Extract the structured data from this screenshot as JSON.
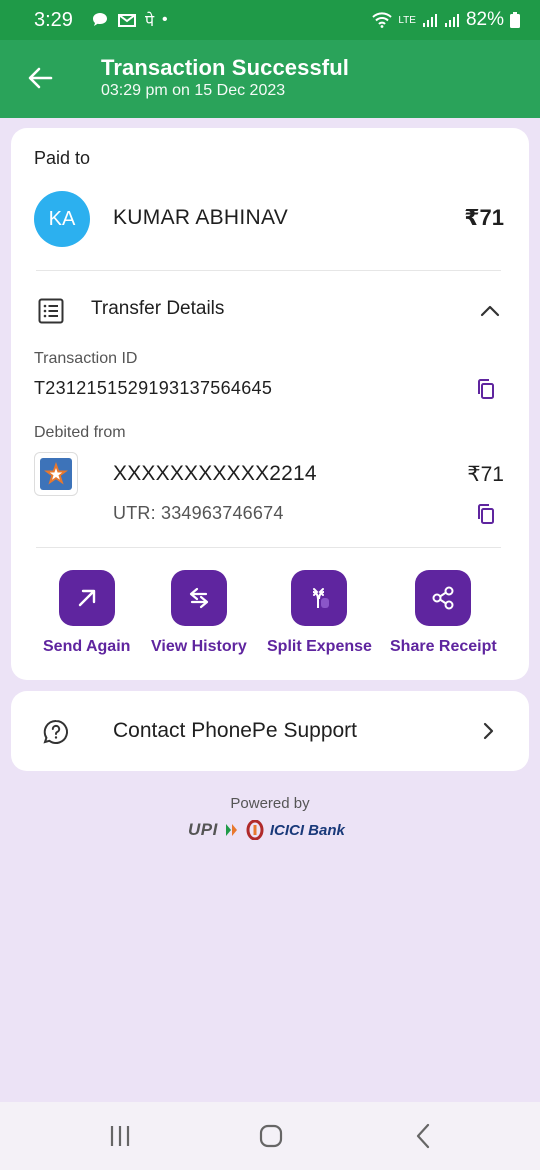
{
  "status_bar": {
    "time": "3:29",
    "net_label": "LTE",
    "battery": "82%"
  },
  "header": {
    "title": "Transaction Successful",
    "subtitle": "03:29 pm on 15 Dec 2023"
  },
  "payee": {
    "section_label": "Paid to",
    "initials": "KA",
    "name": "KUMAR ABHINAV",
    "amount": "₹71"
  },
  "transfer_details": {
    "title": "Transfer Details",
    "transaction_id_label": "Transaction ID",
    "transaction_id": "T2312151529193137564645",
    "debited_from_label": "Debited from",
    "account_number": "XXXXXXXXXXX2214",
    "amount": "₹71",
    "utr": "UTR: 334963746674"
  },
  "actions": [
    {
      "label": "Send Again",
      "icon": "arrow-up-right-icon"
    },
    {
      "label": "View History",
      "icon": "swap-arrows-icon"
    },
    {
      "label": "Split Expense",
      "icon": "split-icon"
    },
    {
      "label": "Share Receipt",
      "icon": "share-icon"
    }
  ],
  "support": {
    "label": "Contact PhonePe Support"
  },
  "footer": {
    "powered_by": "Powered by",
    "upi": "UPI",
    "bank": "ICICI Bank"
  },
  "colors": {
    "status_green": "#1f9a48",
    "header_green": "#2aa35a",
    "brand_purple": "#5f259f",
    "avatar_blue": "#2cb0ef",
    "background": "#ece3f6"
  }
}
